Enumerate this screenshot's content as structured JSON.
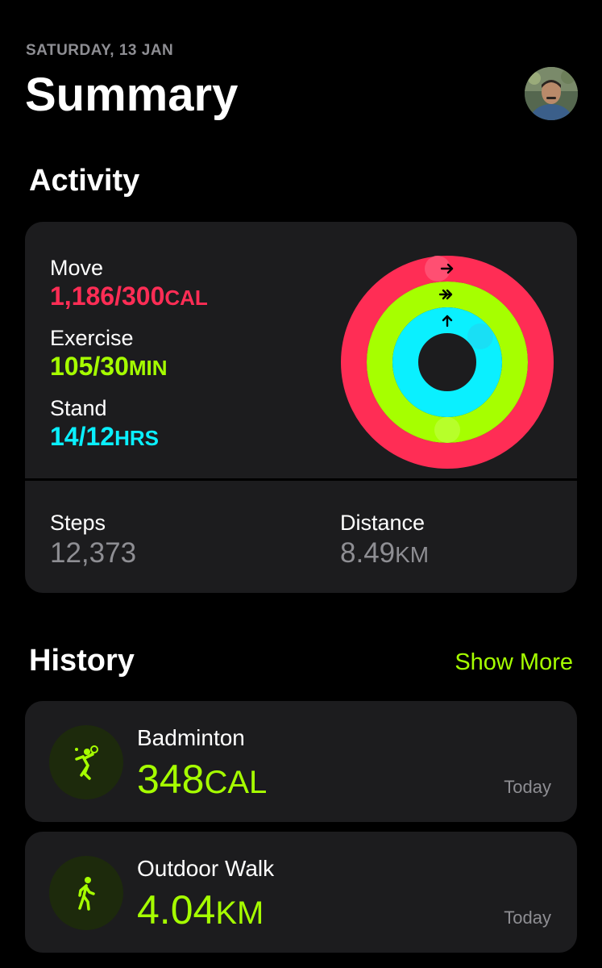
{
  "header": {
    "date": "SATURDAY, 13 JAN",
    "title": "Summary"
  },
  "activity": {
    "section_title": "Activity",
    "move": {
      "label": "Move",
      "value": "1,186/300",
      "unit": "CAL",
      "progress": 3.95
    },
    "exercise": {
      "label": "Exercise",
      "value": "105/30",
      "unit": "MIN",
      "progress": 3.5
    },
    "stand": {
      "label": "Stand",
      "value": "14/12",
      "unit": "HRS",
      "progress": 1.17
    },
    "steps": {
      "label": "Steps",
      "value": "12,373"
    },
    "distance": {
      "label": "Distance",
      "value": "8.49",
      "unit": "KM"
    }
  },
  "history": {
    "section_title": "History",
    "show_more": "Show More",
    "items": [
      {
        "name": "Badminton",
        "value": "348",
        "unit": "CAL",
        "date": "Today",
        "icon": "badminton-icon"
      },
      {
        "name": "Outdoor Walk",
        "value": "4.04",
        "unit": "KM",
        "date": "Today",
        "icon": "walk-icon"
      }
    ]
  },
  "colors": {
    "move": "#ff2d55",
    "exercise": "#a6ff00",
    "stand": "#0af0ff",
    "card": "#1c1c1e",
    "secondary_text": "#8e8e93"
  }
}
